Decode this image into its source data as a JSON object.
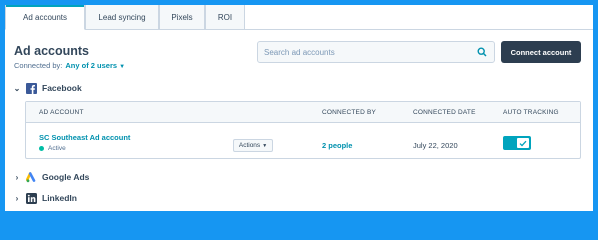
{
  "tabs": [
    {
      "label": "Ad accounts",
      "active": true
    },
    {
      "label": "Lead syncing",
      "active": false
    },
    {
      "label": "Pixels",
      "active": false
    },
    {
      "label": "ROI",
      "active": false
    }
  ],
  "page": {
    "title": "Ad accounts",
    "connected_by_label": "Connected by:",
    "connected_by_value": "Any of 2 users"
  },
  "search": {
    "placeholder": "Search ad accounts"
  },
  "connect_button": "Connect account",
  "sections": {
    "facebook": {
      "label": "Facebook",
      "expanded": true
    },
    "google": {
      "label": "Google Ads",
      "expanded": false
    },
    "linkedin": {
      "label": "LinkedIn",
      "expanded": false
    }
  },
  "table": {
    "headers": {
      "ad_account": "AD ACCOUNT",
      "connected_by": "CONNECTED BY",
      "connected_date": "CONNECTED DATE",
      "auto_tracking": "AUTO TRACKING"
    },
    "rows": [
      {
        "account_name": "SC Southeast Ad account",
        "status": "Active",
        "actions_label": "Actions",
        "connected_by": "2 people",
        "connected_date": "July 22, 2020",
        "auto_tracking": true
      }
    ]
  },
  "colors": {
    "accent": "#00a4bd",
    "link": "#0091ae",
    "primary_button": "#2d3e50",
    "frame_border": "#1696f2",
    "facebook": "#3b5998",
    "linkedin": "#0a66c2"
  }
}
